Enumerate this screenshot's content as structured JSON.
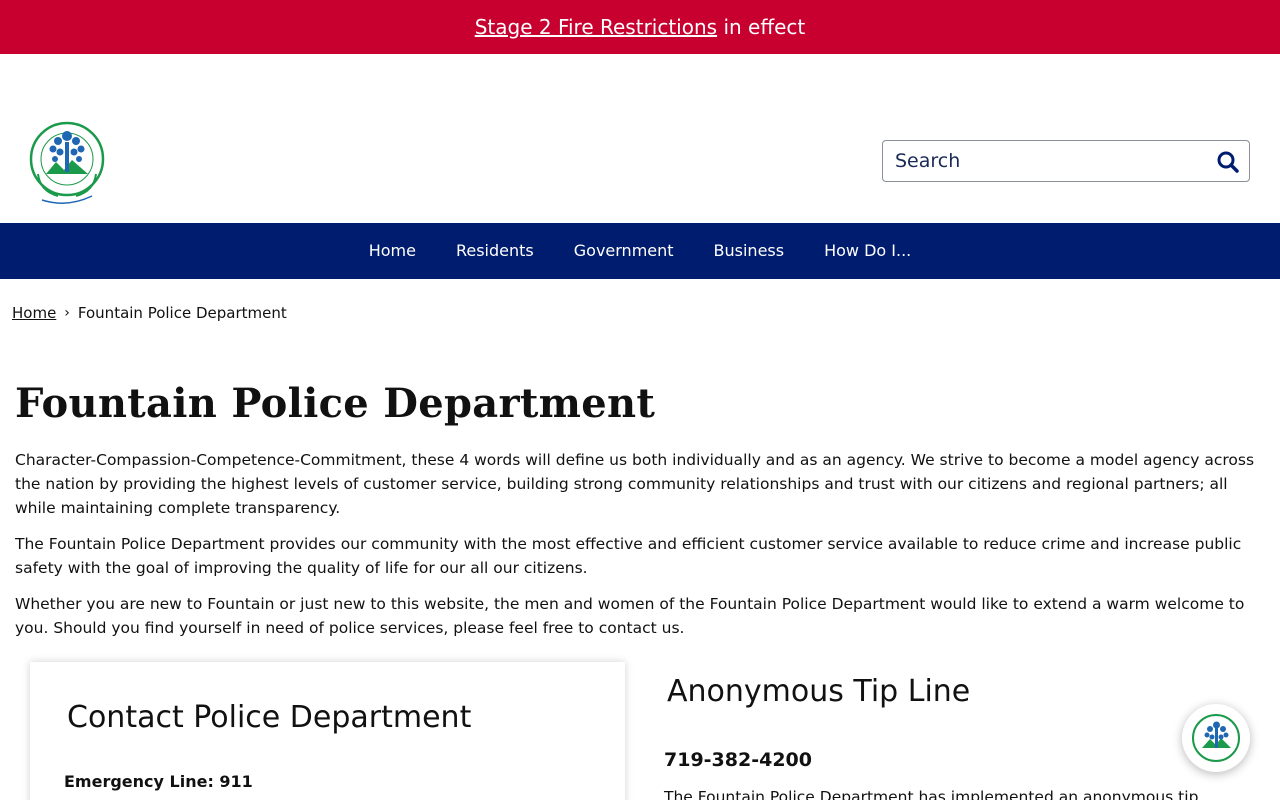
{
  "alert": {
    "link_text": "Stage 2 Fire Restrictions",
    "suffix": "in effect"
  },
  "logo": {
    "alt": "City of Fountain - Pure Colorado"
  },
  "search": {
    "placeholder": "Search"
  },
  "nav": {
    "items": [
      "Home",
      "Residents",
      "Government",
      "Business",
      "How Do I..."
    ]
  },
  "breadcrumb": {
    "home": "Home",
    "current": "Fountain Police Department"
  },
  "page": {
    "title": "Fountain Police Department",
    "paragraphs": [
      "Character-Compassion-Competence-Commitment, these 4 words will define us both individually and as an agency. We strive to become a model agency across the nation by providing the highest levels of customer service, building strong community relationships and trust with our citizens and regional partners; all while maintaining complete transparency.",
      "The Fountain Police Department provides our community with the most effective and efficient customer service available to reduce crime and increase public safety with the goal of improving the quality of life for our all our citizens.",
      "Whether you are new to Fountain or just new to this website, the men and women of the Fountain Police Department would like to extend a warm welcome to you. Should you find yourself in need of police services, please feel free to contact us."
    ]
  },
  "contact": {
    "title": "Contact Police Department",
    "emergency": "Emergency Line: 911"
  },
  "tip_line": {
    "title": "Anonymous Tip Line",
    "phone": "719-382-4200",
    "text": "The Fountain Police Department has implemented an anonymous tip"
  },
  "colors": {
    "alert_bg": "#c8002f",
    "nav_bg": "#001c6e",
    "logo_green": "#1a9a4a",
    "logo_blue": "#1f67b3"
  }
}
